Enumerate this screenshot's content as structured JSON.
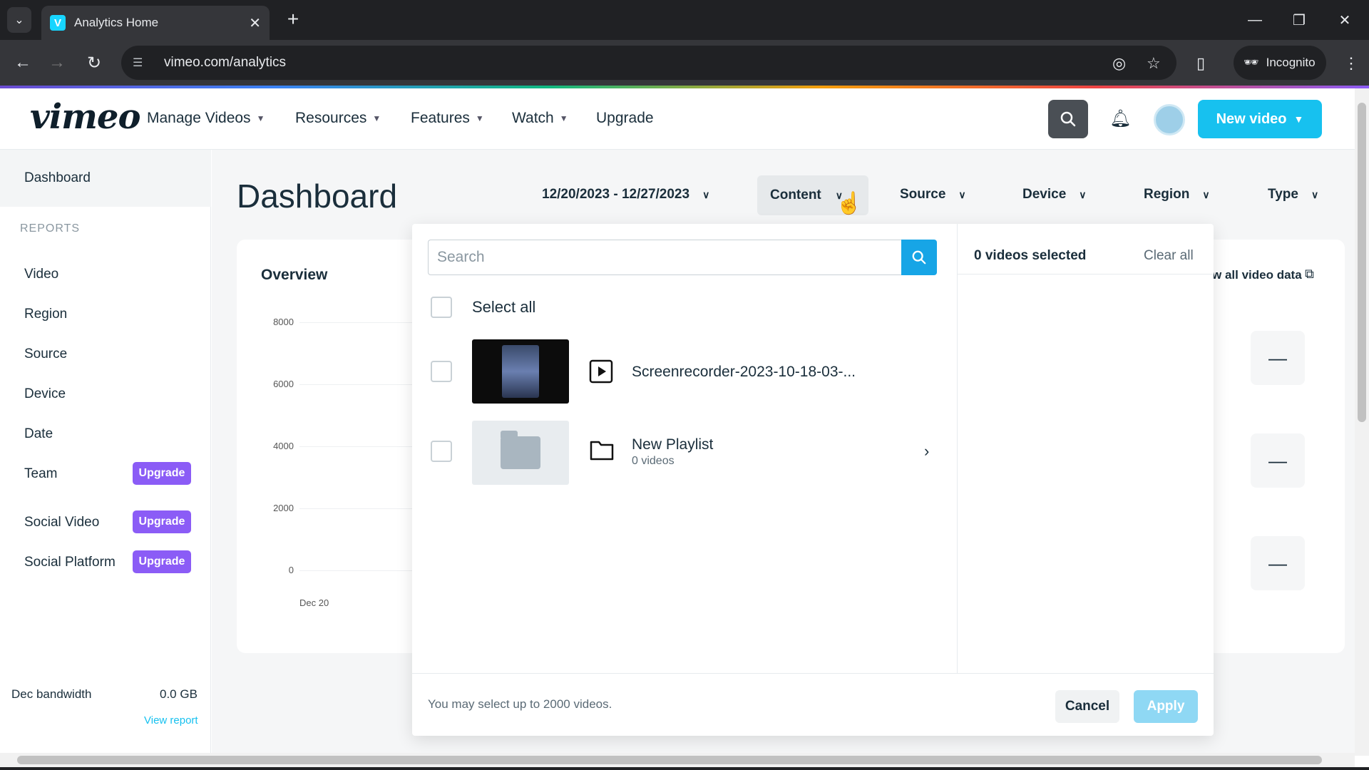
{
  "browser": {
    "tab_title": "Analytics Home",
    "favicon_letter": "V",
    "url": "vimeo.com/analytics",
    "incognito_label": "Incognito"
  },
  "header": {
    "logo": "vimeo",
    "nav": [
      "Manage Videos",
      "Resources",
      "Features",
      "Watch"
    ],
    "upgrade_label": "Upgrade",
    "new_video_label": "New video"
  },
  "sidebar": {
    "dashboard": "Dashboard",
    "reports_heading": "REPORTS",
    "items": [
      "Video",
      "Region",
      "Source",
      "Device",
      "Date",
      "Team",
      "Social Video",
      "Social Platform"
    ],
    "upgrade_badge": "Upgrade",
    "bandwidth_label": "Dec bandwidth",
    "bandwidth_value": "0.0 GB",
    "view_report": "View report"
  },
  "main": {
    "title": "Dashboard",
    "date_range": "12/20/2023 - 12/27/2023",
    "filters": {
      "content": "Content",
      "source": "Source",
      "device": "Device",
      "region": "Region",
      "type": "Type"
    },
    "overview_title": "Overview",
    "y_ticks": [
      "8000",
      "6000",
      "4000",
      "2000",
      "0"
    ],
    "x_tick": "Dec 20",
    "view_all": "w all video data"
  },
  "dropdown": {
    "search_placeholder": "Search",
    "select_all": "Select all",
    "items": [
      {
        "title": "Screenrecorder-2023-10-18-03-...",
        "type": "video"
      },
      {
        "title": "New Playlist",
        "subtitle": "0 videos",
        "type": "playlist"
      }
    ],
    "selected_count": "0 videos selected",
    "clear_all": "Clear all",
    "note": "You may select up to 2000 videos.",
    "cancel_label": "Cancel",
    "apply_label": "Apply"
  },
  "colors": {
    "accent": "#17c1ef",
    "upgrade_badge": "#8b5cf6",
    "search_button": "#17a5e6"
  }
}
